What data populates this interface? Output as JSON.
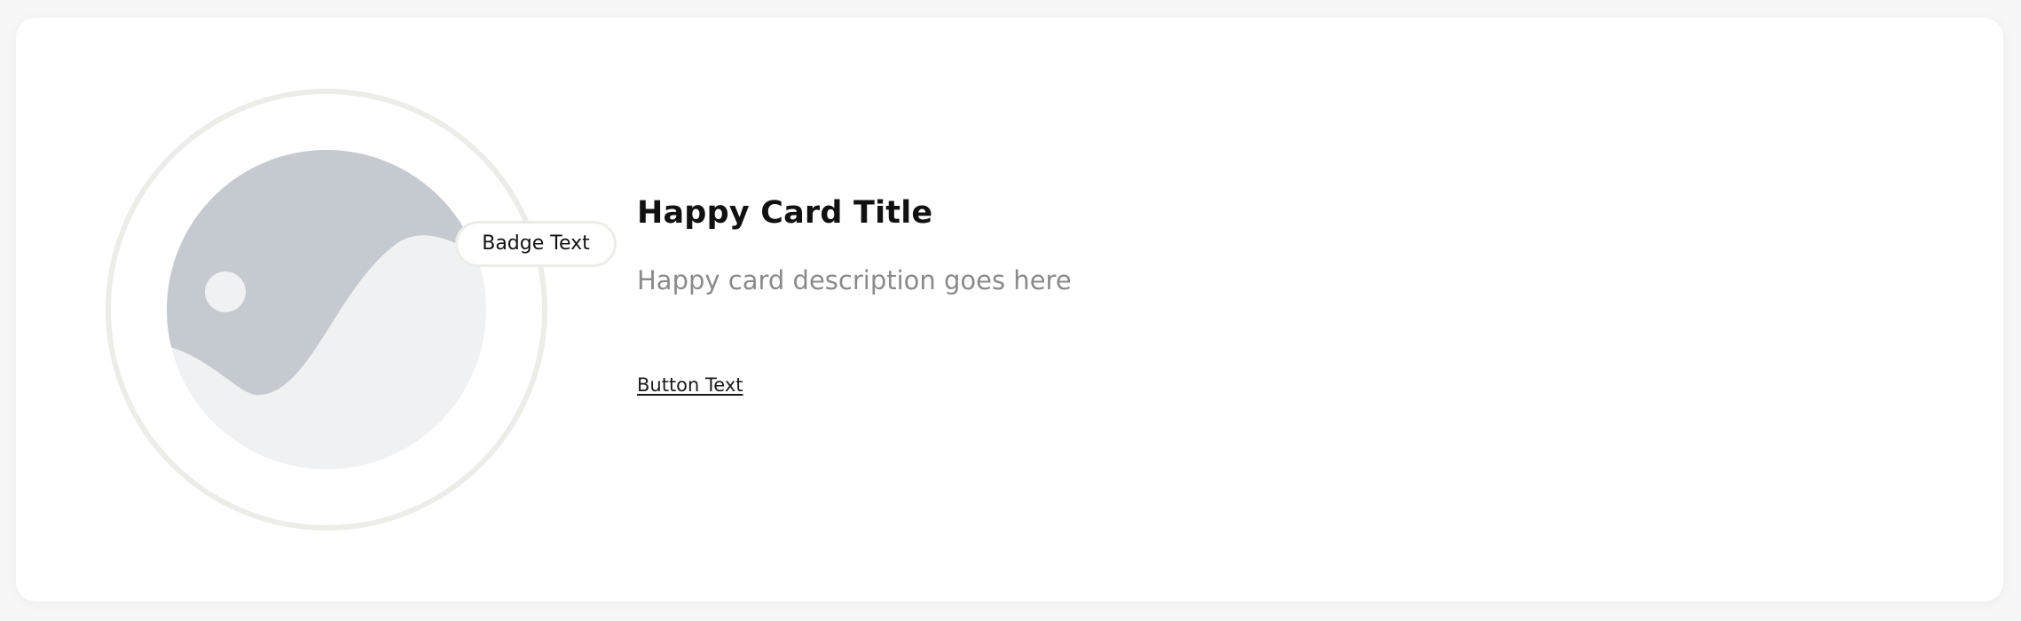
{
  "card": {
    "badge_text": "Badge Text",
    "title": "Happy Card Title",
    "description": "Happy card description goes here",
    "button_text": "Button Text"
  },
  "icons": {
    "media": "image-placeholder-icon"
  },
  "colors": {
    "background": "#f7f7f7",
    "card": "#ffffff",
    "ring": "#ecede9",
    "placeholder_light": "#f0f1f2",
    "placeholder_dark": "#c4cad0",
    "title": "#111111",
    "description": "#8a8a8a"
  }
}
